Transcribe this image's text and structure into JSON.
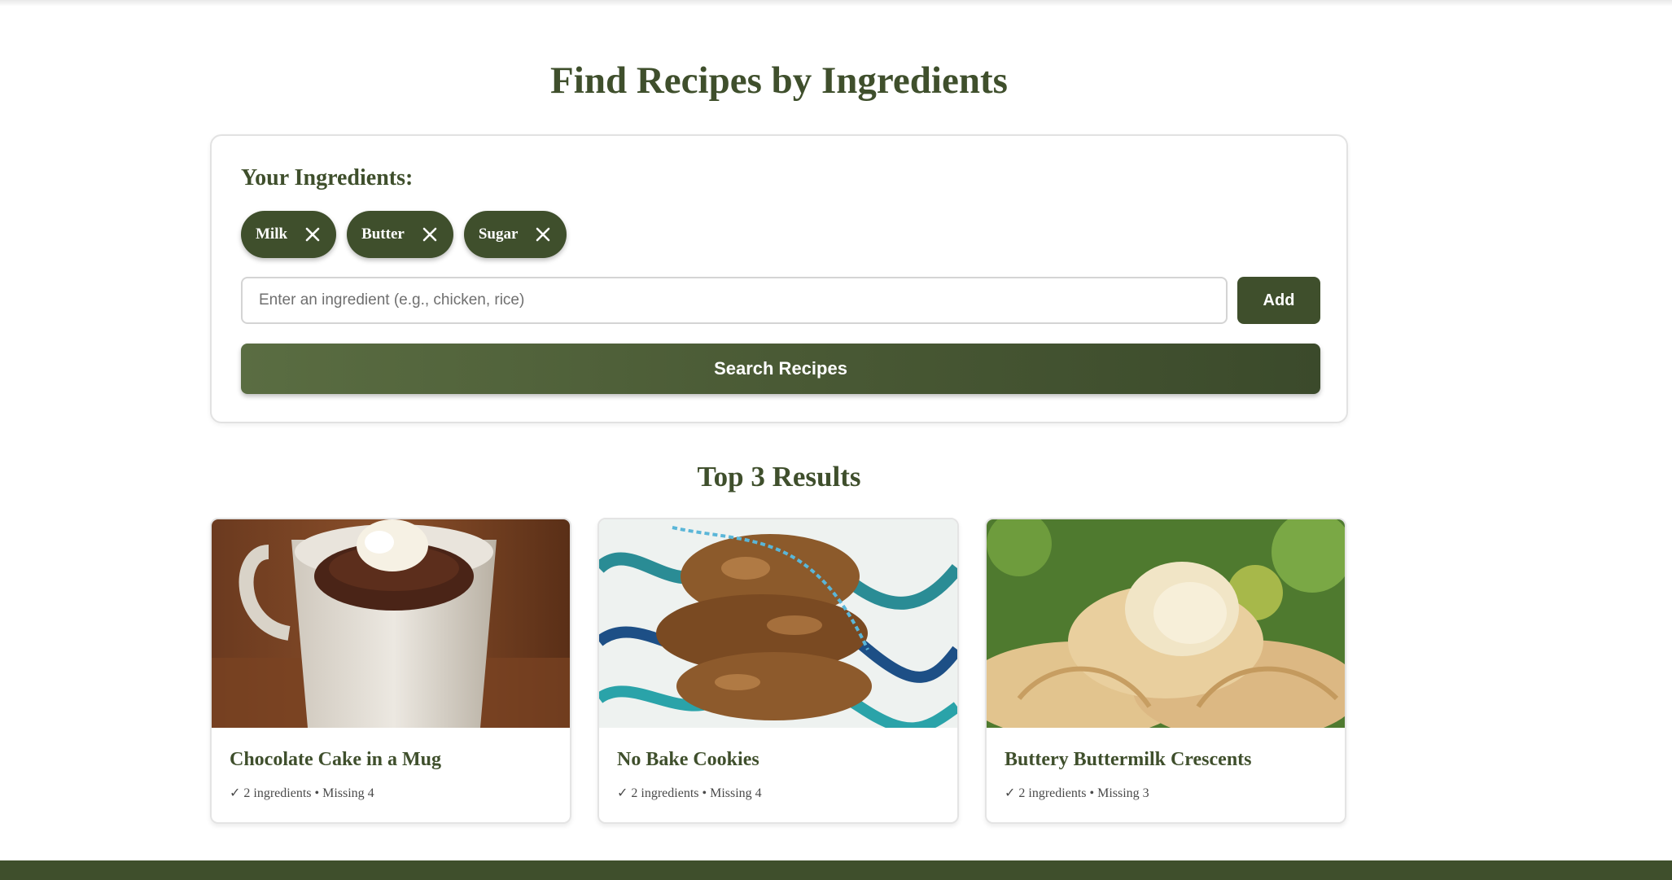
{
  "page": {
    "title": "Find Recipes by Ingredients"
  },
  "ingredients_panel": {
    "heading": "Your Ingredients:",
    "chips": [
      "Milk",
      "Butter",
      "Sugar"
    ],
    "input_placeholder": "Enter an ingredient (e.g., chicken, rice)",
    "input_value": "",
    "add_label": "Add",
    "search_label": "Search Recipes"
  },
  "results": {
    "title": "Top 3 Results",
    "items": [
      {
        "name": "Chocolate Cake in a Mug",
        "meta": "✓ 2 ingredients • Missing 4"
      },
      {
        "name": "No Bake Cookies",
        "meta": "✓ 2 ingredients • Missing 4"
      },
      {
        "name": "Buttery Buttermilk Crescents",
        "meta": "✓ 2 ingredients • Missing 3"
      }
    ]
  },
  "colors": {
    "primary": "#3f4f2c",
    "accent_gradient_start": "#5a6d42",
    "border": "#e2e2e2"
  },
  "icons": {
    "chip_remove": "close-icon",
    "result_status": "check-icon"
  }
}
